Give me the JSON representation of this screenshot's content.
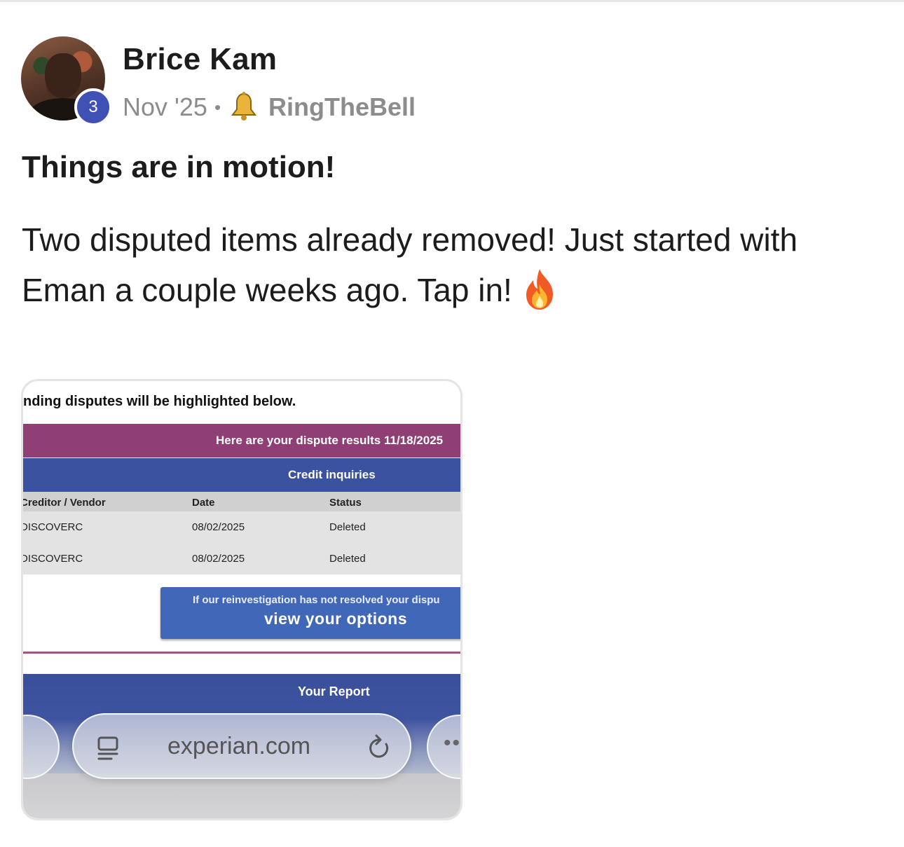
{
  "post": {
    "author": "Brice Kam",
    "level": "3",
    "date": "Nov '25",
    "separator": "•",
    "category": "RingTheBell",
    "category_icon": "bell-icon",
    "title": "Things are in motion!",
    "body": "Two disputed items already removed! Just started with Eman a couple weeks ago. Tap in!",
    "body_emoji": "fire-icon"
  },
  "attachment": {
    "intro": "nding disputes will be highlighted below.",
    "results_header": "Here are your dispute results 11/18/2025",
    "section_header": "Credit inquiries",
    "table": {
      "columns": [
        "Creditor / Vendor",
        "Date",
        "Status"
      ],
      "rows": [
        [
          "DISCOVERC",
          "08/02/2025",
          "Deleted"
        ],
        [
          "DISCOVERC",
          "08/02/2025",
          "Deleted"
        ]
      ]
    },
    "options_button": {
      "small_text": "If our reinvestigation has not resolved your dispu",
      "label": "view your options"
    },
    "report_header": "Your Report",
    "browser": {
      "url": "experian.com",
      "more": "••"
    }
  },
  "colors": {
    "results_bar": "#8f3f74",
    "section_bar": "#3a52a0",
    "options_button": "#4167b8",
    "level_badge": "#3f51b5"
  }
}
